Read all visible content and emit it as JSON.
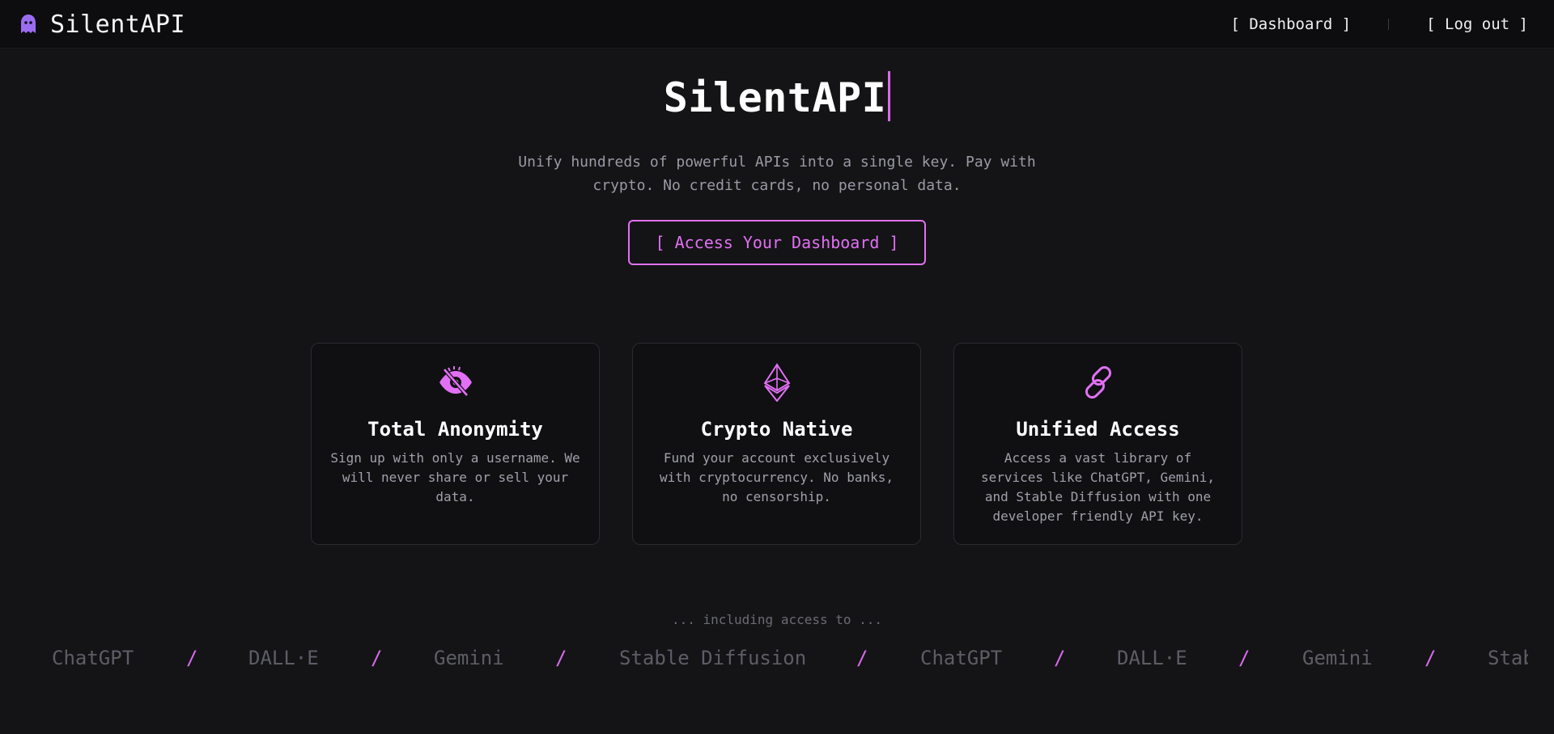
{
  "header": {
    "brand_name": "SilentAPI",
    "brand_icon": "ghost-icon",
    "nav": [
      {
        "label": "[ Dashboard ]"
      },
      {
        "label": "[ Log out ]"
      }
    ]
  },
  "hero": {
    "title": "SilentAPI",
    "subtitle_line1": "Unify hundreds of powerful APIs into a single key. Pay with",
    "subtitle_line2": "crypto. No credit cards, no personal data.",
    "cta_label": "[ Access Your Dashboard ]"
  },
  "features": [
    {
      "icon": "eye-slash-icon",
      "title": "Total Anonymity",
      "text": "Sign up with only a username. We will never share or sell your data."
    },
    {
      "icon": "ethereum-icon",
      "title": "Crypto Native",
      "text": "Fund your account exclusively with cryptocurrency. No banks, no censorship."
    },
    {
      "icon": "link-icon",
      "title": "Unified Access",
      "text": "Access a vast library of services like ChatGPT, Gemini, and Stable Diffusion with one developer friendly API key."
    }
  ],
  "ticker": {
    "intro": "... including access to ...",
    "separator": "/",
    "items": [
      "ChatGPT",
      "DALL·E",
      "Gemini",
      "Stable Diffusion",
      "ChatGPT",
      "DALL·E",
      "Gemini",
      "Stable Diffusion"
    ]
  },
  "colors": {
    "accent": "#e270f4",
    "background": "#141416",
    "card_border": "#2a2a30"
  }
}
